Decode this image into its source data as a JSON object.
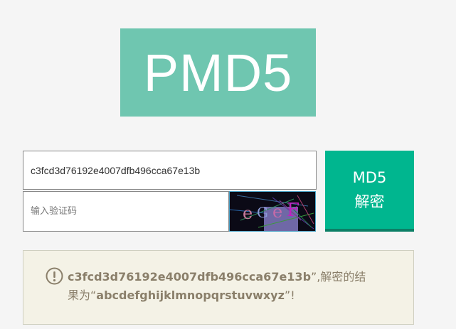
{
  "logo": {
    "text": "PMD5"
  },
  "form": {
    "hash_value": "c3fcd3d76192e4007dfb496cca67e13b",
    "captcha_placeholder": "输入验证码",
    "captcha_text": "eGeF",
    "decrypt_line1": "MD5",
    "decrypt_line2": "解密"
  },
  "result": {
    "hash": "c3fcd3d76192e4007dfb496cca67e13b",
    "middle": "”,解密的结果为“",
    "plain": "abcdefghijklmnopqrstuvwxyz",
    "tail": "”!"
  },
  "colors": {
    "logo_bg": "#6fc6b0",
    "button_bg": "#00b68f",
    "result_bg": "#f4f2e6",
    "result_text": "#8a7f6a"
  },
  "icons": {
    "alert": "exclamation-circle-icon"
  }
}
